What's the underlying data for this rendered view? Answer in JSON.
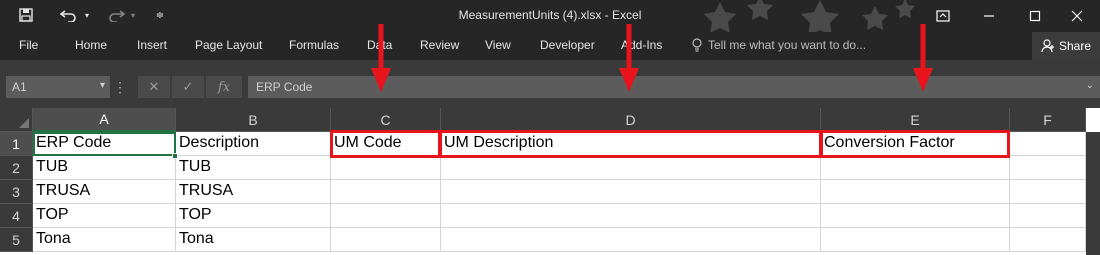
{
  "window": {
    "title": "MeasurementUnits (4).xlsx - Excel"
  },
  "quick_access": {
    "icons": [
      "save-icon",
      "undo-icon",
      "redo-icon",
      "customize-icon"
    ]
  },
  "ribbon": {
    "tabs": [
      "File",
      "Home",
      "Insert",
      "Page Layout",
      "Formulas",
      "Data",
      "Review",
      "View",
      "Developer",
      "Add-Ins"
    ],
    "tell_me": "Tell me what you want to do...",
    "share": "Share"
  },
  "formula_bar": {
    "name_box": "A1",
    "cancel": "✕",
    "enter": "✓",
    "fx": "fx",
    "content": "ERP Code"
  },
  "sheet": {
    "columns": [
      "A",
      "B",
      "C",
      "D",
      "E",
      "F"
    ],
    "rows": [
      "1",
      "2",
      "3",
      "4",
      "5"
    ],
    "cells": [
      [
        "ERP Code",
        "Description",
        "UM Code",
        "UM Description",
        "Conversion Factor",
        ""
      ],
      [
        "TUB",
        "TUB",
        "",
        "",
        "",
        ""
      ],
      [
        "TRUSA",
        "TRUSA",
        "",
        "",
        "",
        ""
      ],
      [
        "TOP",
        "TOP",
        "",
        "",
        "",
        ""
      ],
      [
        "Tona",
        "Tona",
        "",
        "",
        "",
        ""
      ]
    ]
  },
  "colors": {
    "highlight": "#e8141b",
    "selection": "#217346",
    "chrome": "#262626"
  }
}
